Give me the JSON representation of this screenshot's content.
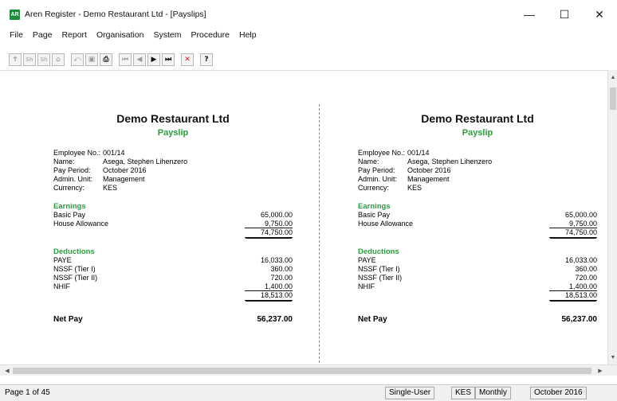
{
  "window": {
    "title": "Aren Register - Demo Restaurant Ltd - [Payslips]",
    "icon_label": "AR",
    "controls": [
      "—",
      "☐",
      "✕"
    ]
  },
  "menu": [
    "File",
    "Page",
    "Report",
    "Organisation",
    "System",
    "Procedure",
    "Help"
  ],
  "toolbar": {
    "buttons": [
      {
        "name": "insert-icon",
        "glyph": "✝"
      },
      {
        "name": "sh-prev-icon",
        "glyph": "Sh"
      },
      {
        "name": "sh-next-icon",
        "glyph": "Sh"
      },
      {
        "name": "home-icon",
        "glyph": "⌂"
      },
      {
        "name": "undo-icon",
        "glyph": "⤺"
      },
      {
        "name": "save-icon",
        "glyph": "▣"
      },
      {
        "name": "print-icon",
        "glyph": "⎙"
      },
      {
        "name": "first-record-icon",
        "glyph": "⏮"
      },
      {
        "name": "prev-record-icon",
        "glyph": "◀"
      },
      {
        "name": "next-record-icon",
        "glyph": "▶"
      },
      {
        "name": "last-record-icon",
        "glyph": "⏭"
      },
      {
        "name": "close-icon",
        "glyph": "✕"
      },
      {
        "name": "help-icon",
        "glyph": "?"
      }
    ]
  },
  "payslip": {
    "company": "Demo Restaurant Ltd",
    "doc_title": "Payslip",
    "labels": {
      "employee_no": "Employee No.:",
      "name": "Name:",
      "pay_period": "Pay Period:",
      "admin_unit": "Admin. Unit:",
      "currency": "Currency:"
    },
    "employee_no": "001/14",
    "name": "Asega, Stephen Lihenzero",
    "pay_period": "October 2016",
    "admin_unit": "Management",
    "currency": "KES",
    "earnings_heading": "Earnings",
    "basic_pay_label": "Basic Pay",
    "basic_pay": "65,000.00",
    "house_allowance_label": "House Allowance",
    "house_allowance": "9,750.00",
    "gross_total": "74,750.00",
    "deductions_heading": "Deductions",
    "paye_label": "PAYE",
    "paye": "16,033.00",
    "nssf1_label": "NSSF (Tier I)",
    "nssf1": "360.00",
    "nssf2_label": "NSSF (Tier II)",
    "nssf2": "720.00",
    "nhif_label": "NHIF",
    "nhif": "1,400.00",
    "deductions_total": "18,513.00",
    "net_pay_label": "Net Pay",
    "net_pay": "56,237.00"
  },
  "status": {
    "page": "Page 1 of 45",
    "mode": "Single-User",
    "currency": "KES",
    "frequency": "Monthly",
    "period": "October 2016"
  }
}
